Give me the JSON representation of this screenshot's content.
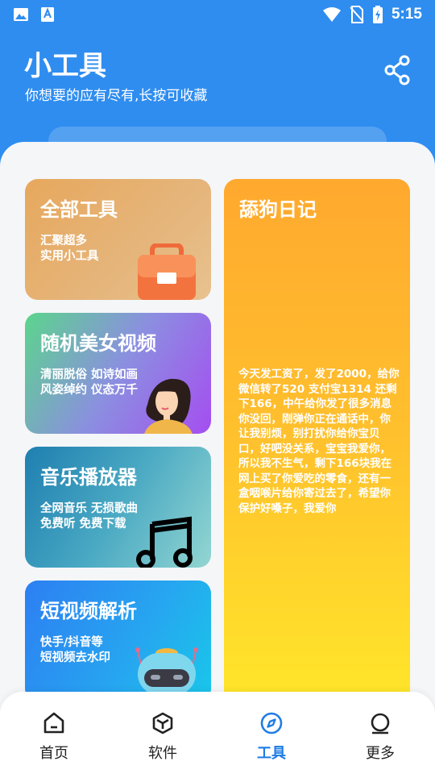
{
  "status_bar": {
    "time": "5:15",
    "left_icons": [
      "image-icon",
      "font-download-icon"
    ],
    "right_icons": [
      "wifi-icon",
      "no-sim-icon",
      "battery-charging-icon"
    ]
  },
  "header": {
    "title": "小工具",
    "subtitle": "你想要的应有尽有,长按可收藏",
    "share_icon": "share-icon"
  },
  "cards": [
    {
      "id": "all-tools",
      "title": "全部工具",
      "desc": "汇聚超多\n实用小工具",
      "icon": "toolbox-icon",
      "colors": [
        "#e7a85d",
        "#e8c28f"
      ]
    },
    {
      "id": "random-video",
      "title": "随机美女视频",
      "desc": "清丽脱俗 如诗如画\n风姿绰约 仪态万千",
      "icon": "girl-illustration",
      "colors": [
        "#5bd58c",
        "#a54ef0"
      ]
    },
    {
      "id": "music-player",
      "title": "音乐播放器",
      "desc": "全网音乐 无损歌曲\n免费听 免费下载",
      "icon": "music-note-icon",
      "colors": [
        "#1f7fb0",
        "#93d6d1"
      ]
    },
    {
      "id": "video-parse",
      "title": "短视频解析",
      "desc": "快手/抖音等\n短视频去水印",
      "icon": "robot-icon",
      "colors": [
        "#2d7ff2",
        "#19c7e9"
      ]
    }
  ],
  "diary_card": {
    "title": "舔狗日记",
    "text": "今天发工资了，发了2000，给你微信转了520 支付宝1314 还剩下166，中午给你发了很多消息你没回，刚弹你正在通话中，你让我别烦，别打扰你给你宝贝口，好吧没关系，宝宝我爱你，所以我不生气，剩下166块我在网上买了你爱吃的零食，还有一盒咽喉片给你寄过去了，希望你保护好嗓子，我爱你",
    "colors": [
      "#ffa92e",
      "#ffe62a"
    ]
  },
  "bottom_nav": {
    "items": [
      {
        "label": "首页",
        "icon": "home-icon",
        "active": false
      },
      {
        "label": "软件",
        "icon": "cube-icon",
        "active": false
      },
      {
        "label": "工具",
        "icon": "compass-icon",
        "active": true
      },
      {
        "label": "更多",
        "icon": "more-icon",
        "active": false
      }
    ],
    "active_color": "#1f7ce6"
  }
}
